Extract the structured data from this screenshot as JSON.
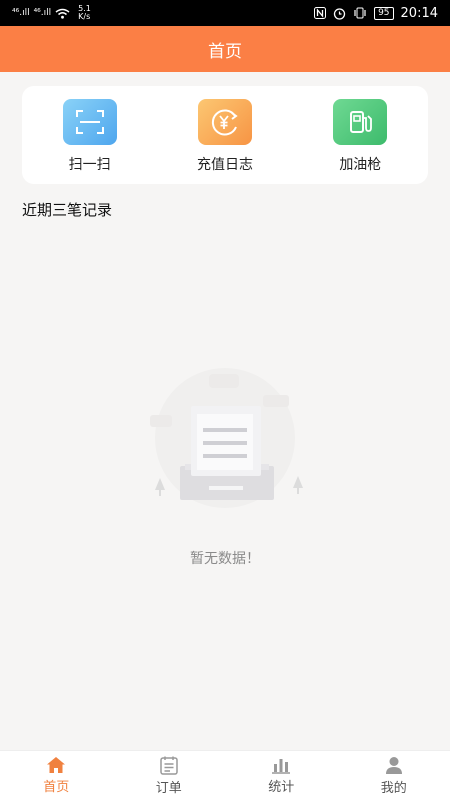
{
  "status_bar": {
    "sig1": "⁴⁶.ıll",
    "sig2": "⁴⁶.ıll",
    "speed_value": "5.1",
    "speed_unit": "K/s",
    "battery": "95",
    "time": "20:14"
  },
  "header": {
    "title": "首页"
  },
  "quick_actions": [
    {
      "label": "扫一扫",
      "icon": "scan-icon"
    },
    {
      "label": "充值日志",
      "icon": "recharge-log-icon"
    },
    {
      "label": "加油枪",
      "icon": "fuel-nozzle-icon"
    }
  ],
  "section": {
    "title": "近期三笔记录"
  },
  "empty_state": {
    "text": "暂无数据！"
  },
  "tabs": [
    {
      "label": "首页",
      "icon": "home-icon",
      "active": true
    },
    {
      "label": "订单",
      "icon": "order-icon",
      "active": false
    },
    {
      "label": "统计",
      "icon": "stats-icon",
      "active": false
    },
    {
      "label": "我的",
      "icon": "user-icon",
      "active": false
    }
  ],
  "colors": {
    "accent": "#fb7f45",
    "active_tab": "#f0813f"
  }
}
